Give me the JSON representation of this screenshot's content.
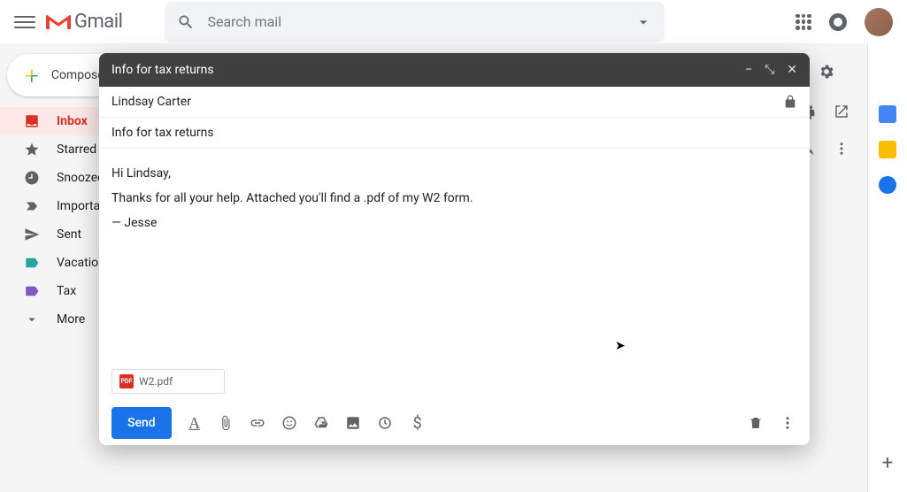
{
  "header": {
    "logo_text": "Gmail",
    "search_placeholder": "Search mail"
  },
  "sidebar": {
    "compose_label": "Compose",
    "items": [
      {
        "label": "Inbox",
        "icon": "inbox"
      },
      {
        "label": "Starred",
        "icon": "star"
      },
      {
        "label": "Snoozed",
        "icon": "clock"
      },
      {
        "label": "Important",
        "icon": "important"
      },
      {
        "label": "Sent",
        "icon": "sent"
      },
      {
        "label": "Vacation",
        "icon": "label-teal"
      },
      {
        "label": "Tax",
        "icon": "label-purple"
      },
      {
        "label": "More",
        "icon": "chevron-down"
      }
    ],
    "active_index": 0
  },
  "compose": {
    "title": "Info for tax returns",
    "to": "Lindsay Carter",
    "subject": "Info for tax returns",
    "body_lines": [
      "Hi Lindsay,",
      "Thanks for all your help. Attached you'll find a .pdf of my W2 form.",
      "— Jesse"
    ],
    "attachment": {
      "badge": "PDF",
      "filename": "W2.pdf"
    },
    "send_label": "Send"
  }
}
